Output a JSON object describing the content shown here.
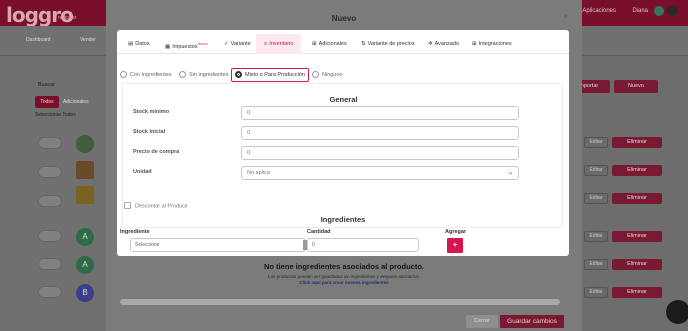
{
  "background": {
    "logo": "loggro",
    "logo_sub": "restobar",
    "user_left": "Aplicaciones",
    "user_name": "Diana",
    "avatar_letter": "D",
    "nav": [
      "Dashboard",
      "Vender"
    ],
    "buscar_label": "Buscar",
    "tab_active": "Todos",
    "tab_other": "Adicionales",
    "select_all": "Seleccionar Todos",
    "import_button": "Importar",
    "new_button": "Nuevo",
    "editar": "Editar",
    "eliminar": "Eliminar",
    "row_letters": [
      "A",
      "A",
      "B"
    ]
  },
  "modal": {
    "title": "Nuevo",
    "close": "×",
    "tabs": [
      {
        "icon": "▤",
        "label": "Datos"
      },
      {
        "icon": "▦",
        "label": "Impuestos",
        "badge": "Nuevo"
      },
      {
        "icon": "✓",
        "label": "Variante"
      },
      {
        "icon": "≡",
        "label": "Inventario"
      },
      {
        "icon": "⊞",
        "label": "Adicionales"
      },
      {
        "icon": "⇅",
        "label": "Variante de precios"
      },
      {
        "icon": "✲",
        "label": "Avanzado"
      },
      {
        "icon": "⊞",
        "label": "Integraciones"
      }
    ],
    "active_tab": "Inventario",
    "radio_options": [
      "Con ingredientes",
      "Sin ingredientes",
      "Mixto o Para Producción",
      "Ninguno"
    ],
    "radio_selected": "Mixto o Para Producción",
    "general": {
      "title": "General",
      "stock_minimo_label": "Stock mínimo",
      "stock_minimo_value": "0",
      "stock_inicial_label": "Stock inicial",
      "stock_inicial_value": "0",
      "precio_compra_label": "Precio de compra",
      "precio_compra_value": "0",
      "unidad_label": "Unidad",
      "unidad_value": "No aplica"
    },
    "descontar_label": "Descontar al Producir",
    "ingredientes": {
      "title": "Ingredientes",
      "col_ingrediente": "Ingrediente",
      "col_cantidad": "Cantidad",
      "col_agregar": "Agregar",
      "select_placeholder": "Seleccione",
      "qty_value": "0",
      "add_symbol": "+"
    },
    "empty_title": "No tiene ingredientes asociados al producto.",
    "empty_sub": "Los productos pueden ser guardados sin ingredientes y después asociarlos.",
    "empty_link": "Click aquí para crear nuevos ingredientes",
    "cerrar": "Cerrar",
    "guardar": "Guardar cambios"
  }
}
